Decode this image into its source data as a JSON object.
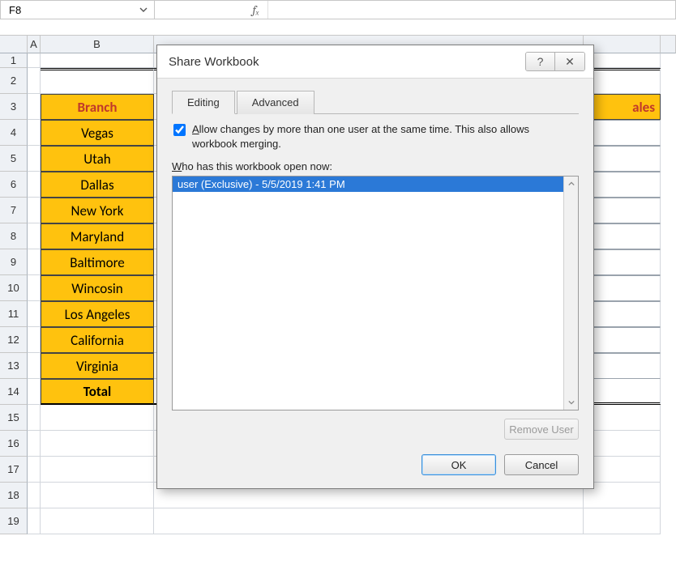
{
  "formula_bar": {
    "name_box": "F8",
    "fx_label": "fₓ",
    "formula": ""
  },
  "columns": {
    "A": "A",
    "B": "B"
  },
  "rows": [
    "1",
    "2",
    "3",
    "4",
    "5",
    "6",
    "7",
    "8",
    "9",
    "10",
    "11",
    "12",
    "13",
    "14",
    "15",
    "16",
    "17",
    "18",
    "19"
  ],
  "sheet": {
    "branch_header": "Branch",
    "sales_header_fragment": "ales",
    "branches": [
      "Vegas",
      "Utah",
      "Dallas",
      "New York",
      "Maryland",
      "Baltimore",
      "Wincosin",
      "Los Angeles",
      "California",
      "Virginia"
    ],
    "total_label": "Total"
  },
  "dialog": {
    "title": "Share Workbook",
    "help_glyph": "?",
    "close_glyph": "✕",
    "tabs": {
      "editing": "Editing",
      "advanced": "Advanced"
    },
    "allow_prefix_u": "A",
    "allow_rest": "llow changes by more than one user at the same time.  This also allows workbook merging.",
    "who_prefix_u": "W",
    "who_rest": "ho has this workbook open now:",
    "users": [
      "user (Exclusive) - 5/5/2019 1:41 PM"
    ],
    "remove_user": "Remove User",
    "ok": "OK",
    "cancel": "Cancel"
  }
}
